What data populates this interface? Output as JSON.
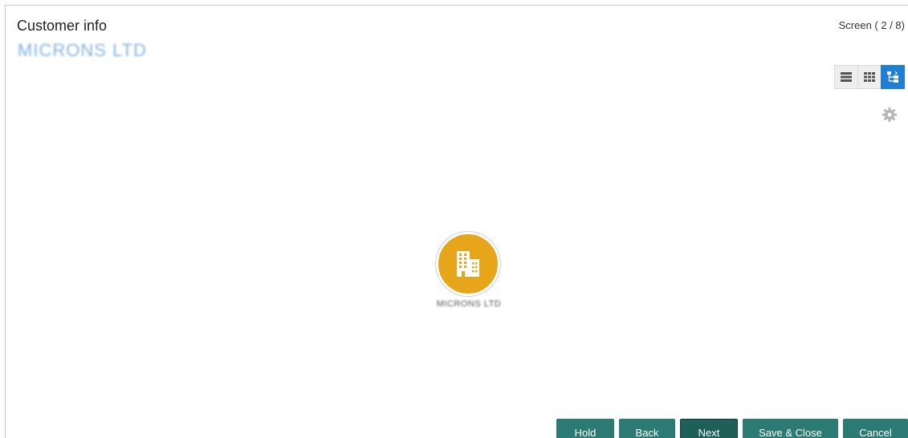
{
  "header": {
    "title": "Customer info",
    "subtitle": "MICRONS LTD",
    "screen_counter": "Screen ( 2 / 8)"
  },
  "view_toggle": {
    "options": [
      "list-view",
      "grid-view",
      "hierarchy-view"
    ],
    "active": "hierarchy-view",
    "accent_color": "#1f7fd6"
  },
  "node": {
    "icon": "building-icon",
    "label": "MICRONS LTD",
    "color": "#e7a51a"
  },
  "footer": {
    "hold": "Hold",
    "back": "Back",
    "next": "Next",
    "save_close": "Save & Close",
    "cancel": "Cancel",
    "button_color": "#2c7a74"
  }
}
